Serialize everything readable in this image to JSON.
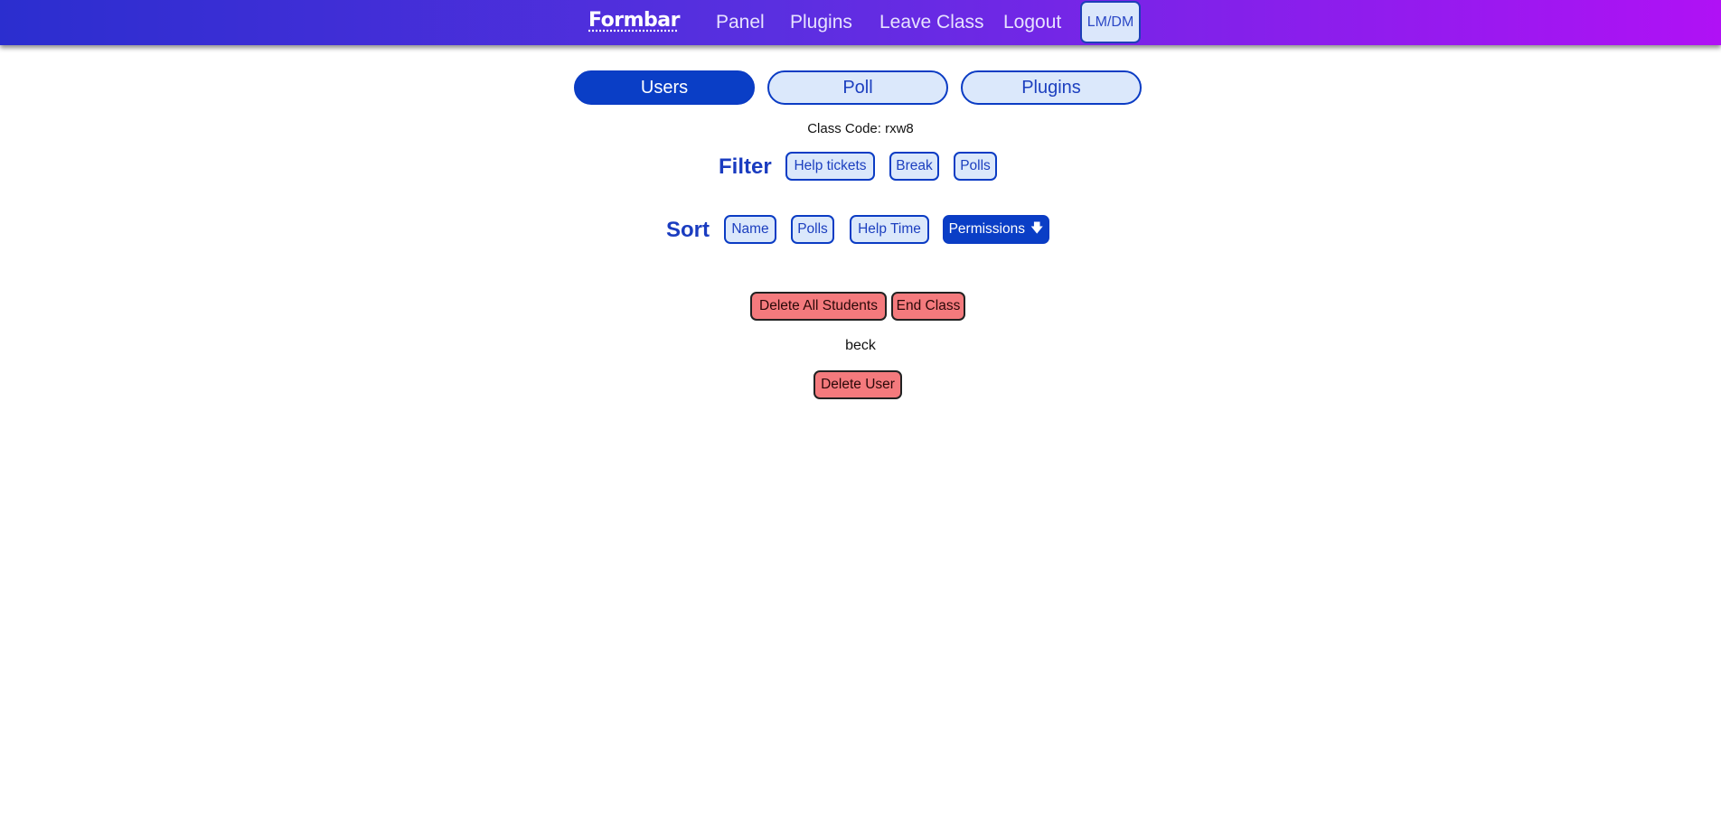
{
  "nav": {
    "brand": "Formbar",
    "links": [
      "Panel",
      "Plugins",
      "Leave Class",
      "Logout"
    ],
    "theme_toggle": "LM/DM"
  },
  "tabs": [
    {
      "label": "Users",
      "active": true
    },
    {
      "label": "Poll",
      "active": false
    },
    {
      "label": "Plugins",
      "active": false
    }
  ],
  "class_code": "Class Code: rxw8",
  "filter": {
    "label": "Filter",
    "options": [
      "Help tickets",
      "Break",
      "Polls"
    ]
  },
  "sort": {
    "label": "Sort",
    "options": [
      "Name",
      "Polls",
      "Help Time",
      "Permissions"
    ],
    "active_option": "Permissions",
    "active_direction_icon": "arrow-down-icon"
  },
  "actions": {
    "delete_all": "Delete All Students",
    "end_class": "End Class"
  },
  "students": [
    {
      "name": "beck",
      "delete_label": "Delete User"
    }
  ],
  "colors": {
    "nav_gradient_start": "#2b2ecf",
    "nav_gradient_end": "#b011f5",
    "primary": "#0a3ec6",
    "pill_bg": "#dbe8fb",
    "danger": "#f47a7d"
  }
}
